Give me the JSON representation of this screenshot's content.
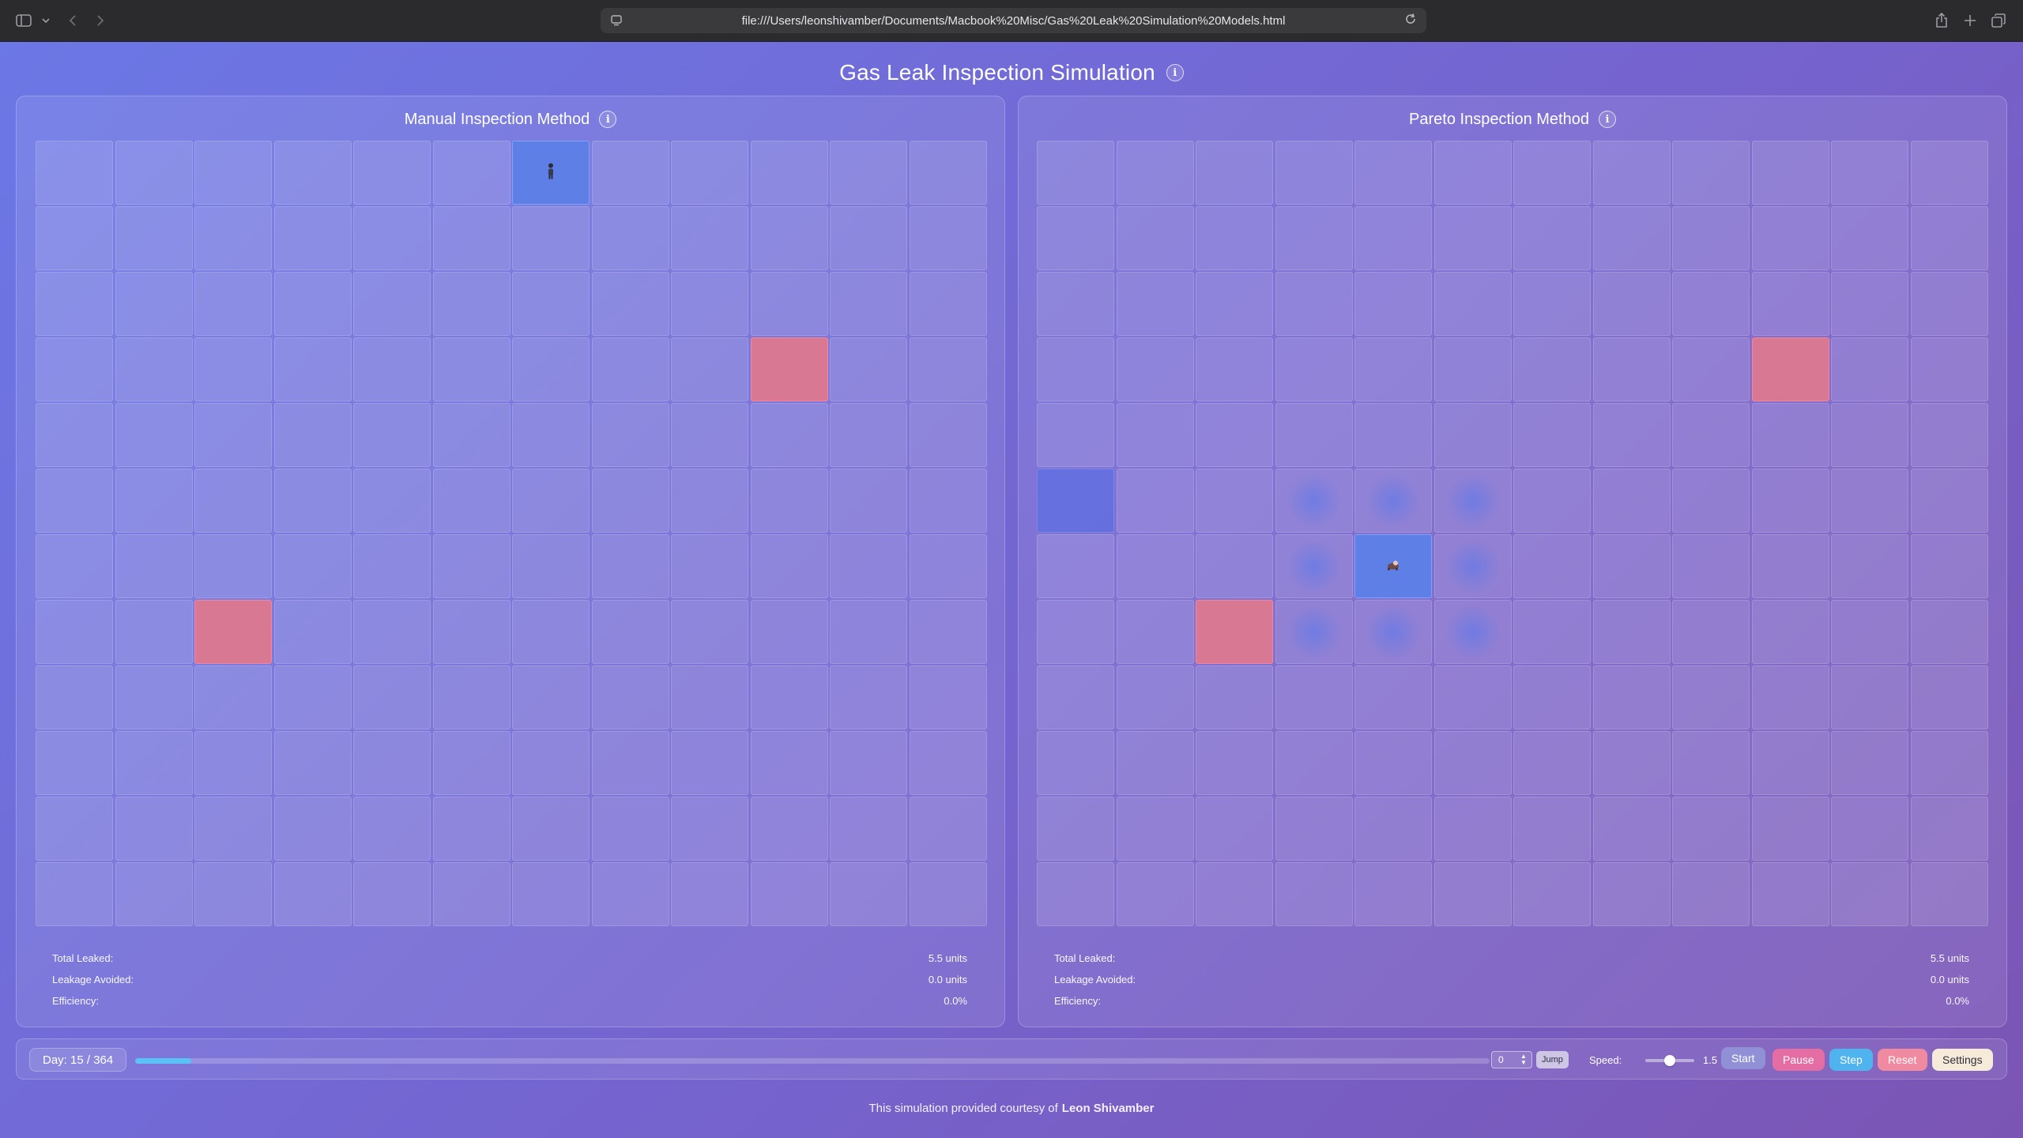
{
  "browser": {
    "url": "file:///Users/leonshivamber/Documents/Macbook%20Misc/Gas%20Leak%20Simulation%20Models.html"
  },
  "page": {
    "title": "Gas Leak Inspection Simulation"
  },
  "panels": [
    {
      "title": "Manual Inspection Method",
      "leaks": [
        [
          3,
          9
        ],
        [
          7,
          2
        ]
      ],
      "inspector": [
        0,
        6
      ],
      "visited": [],
      "halo": [],
      "stats": [
        {
          "label": "Total Leaked:",
          "value": "5.5 units"
        },
        {
          "label": "Leakage Avoided:",
          "value": "0.0 units"
        },
        {
          "label": "Efficiency:",
          "value": "0.0%"
        }
      ]
    },
    {
      "title": "Pareto Inspection Method",
      "leaks": [
        [
          3,
          9
        ],
        [
          7,
          2
        ]
      ],
      "inspector": [
        6,
        4
      ],
      "visited": [
        [
          5,
          0
        ]
      ],
      "halo": [
        [
          5,
          3
        ],
        [
          5,
          4
        ],
        [
          5,
          5
        ],
        [
          6,
          3
        ],
        [
          6,
          5
        ],
        [
          7,
          3
        ],
        [
          7,
          4
        ],
        [
          7,
          5
        ]
      ],
      "stats": [
        {
          "label": "Total Leaked:",
          "value": "5.5 units"
        },
        {
          "label": "Leakage Avoided:",
          "value": "0.0 units"
        },
        {
          "label": "Efficiency:",
          "value": "0.0%"
        }
      ]
    }
  ],
  "controls": {
    "day_label": "Day: 15 / 364",
    "day_current": 15,
    "day_total": 364,
    "jump_value": "0",
    "jump_label": "Jump",
    "speed_label": "Speed:",
    "speed_value": "1.5",
    "speed_fraction": 0.5,
    "start_label": "Start",
    "pause_label": "Pause",
    "step_label": "Step",
    "reset_label": "Reset",
    "settings_label": "Settings"
  },
  "colors": {
    "leak": "#d87892",
    "inspector": "#5e7fe6",
    "progress": "#5bc2f5",
    "start": "#8f90d6",
    "pause": "#e46ea3",
    "step": "#4fb4ee",
    "reset": "#ef8aa0",
    "settings": "#f6ead8"
  },
  "footer": {
    "text": "This simulation provided courtesy of",
    "author": "Leon Shivamber"
  }
}
